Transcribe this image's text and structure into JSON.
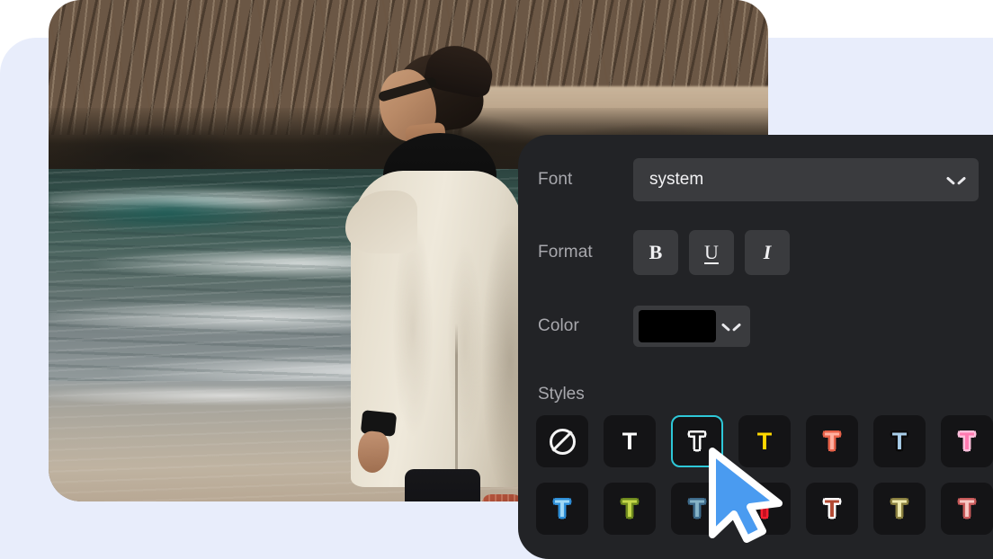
{
  "app": {
    "scene_description": "Photo editor text-style panel over a beach photo"
  },
  "photo": {
    "alt": "Man in cream trench coat and black hoodie standing on a beach looking up at rocky cliffs with breaking waves"
  },
  "panel": {
    "background_color": "#222326",
    "font_row": {
      "label": "Font",
      "value": "system",
      "chevron_icon": "chevron-down-icon"
    },
    "format_row": {
      "label": "Format",
      "buttons": [
        {
          "name": "bold",
          "glyph": "B"
        },
        {
          "name": "underline",
          "glyph": "U"
        },
        {
          "name": "italic",
          "glyph": "I"
        }
      ]
    },
    "color_row": {
      "label": "Color",
      "value": "#000000",
      "chevron_icon": "chevron-down-icon"
    },
    "styles_section": {
      "label": "Styles",
      "selected_index": 2,
      "selection_color": "#2ec8d8",
      "items": [
        {
          "name": "none",
          "glyph": "",
          "fill": "",
          "outline": "",
          "icon": "no-style-icon"
        },
        {
          "name": "plain-white",
          "glyph": "T",
          "fill": "#ffffff",
          "outline": ""
        },
        {
          "name": "outline-white",
          "glyph": "T",
          "fill": "#141416",
          "outline": "#ffffff"
        },
        {
          "name": "yellow",
          "glyph": "T",
          "fill": "#ffd900",
          "outline": ""
        },
        {
          "name": "salmon-outline",
          "glyph": "T",
          "fill": "#ffb0a0",
          "outline": "#e8624a"
        },
        {
          "name": "lightblue-shadow",
          "glyph": "T",
          "fill": "#a8cde8",
          "outline": "#0a0a0a"
        },
        {
          "name": "pink-outline",
          "glyph": "T",
          "fill": "#ff7ab0",
          "outline": "#ffc0dc"
        },
        {
          "name": "skyblue-glow",
          "glyph": "T",
          "fill": "#9fd8f5",
          "outline": "#2f8fd8"
        },
        {
          "name": "olive-green",
          "glyph": "T",
          "fill": "#c5d84a",
          "outline": "#6f8a1e"
        },
        {
          "name": "steel-blue",
          "glyph": "T",
          "fill": "#86b4c8",
          "outline": "#3d6a8a"
        },
        {
          "name": "red-neon",
          "glyph": "T",
          "fill": "#c41020",
          "outline": "#ff2030"
        },
        {
          "name": "brick-white",
          "glyph": "T",
          "fill": "#b34a33",
          "outline": "#ffffff"
        },
        {
          "name": "cream-olive",
          "glyph": "T",
          "fill": "#efe9ae",
          "outline": "#8a8040"
        },
        {
          "name": "blush-rose",
          "glyph": "T",
          "fill": "#f7c8c4",
          "outline": "#c85a5a"
        }
      ]
    }
  },
  "cursor": {
    "icon": "mouse-pointer-icon",
    "fill_color": "#4a9bf0",
    "stroke_color": "#ffffff"
  },
  "backdrop": {
    "card_color": "#e8edfb"
  }
}
